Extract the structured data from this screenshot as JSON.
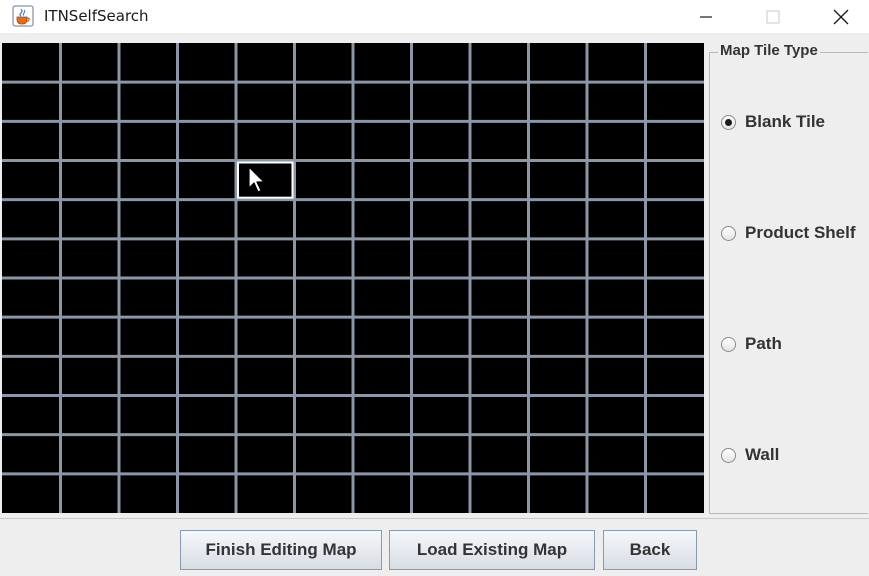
{
  "window": {
    "title": "ITNSelfSearch",
    "app_icon": "java-cup-icon",
    "controls": {
      "minimize": "minimize-icon",
      "maximize": "maximize-icon",
      "close": "close-icon"
    }
  },
  "map_grid": {
    "columns": 12,
    "rows": 12,
    "tile_color": "#000000",
    "gridline_color": "#8c96a6",
    "hovered_tile": {
      "column": 5,
      "row": 4
    },
    "hover_border_color": "#ffffff"
  },
  "tile_type_panel": {
    "legend": "Map Tile Type",
    "options": [
      {
        "label": "Blank Tile",
        "selected": true
      },
      {
        "label": "Product Shelf",
        "selected": false
      },
      {
        "label": "Path",
        "selected": false
      },
      {
        "label": "Wall",
        "selected": false
      }
    ]
  },
  "actions": {
    "finish_label": "Finish Editing Map",
    "load_label": "Load Existing Map",
    "back_label": "Back"
  }
}
